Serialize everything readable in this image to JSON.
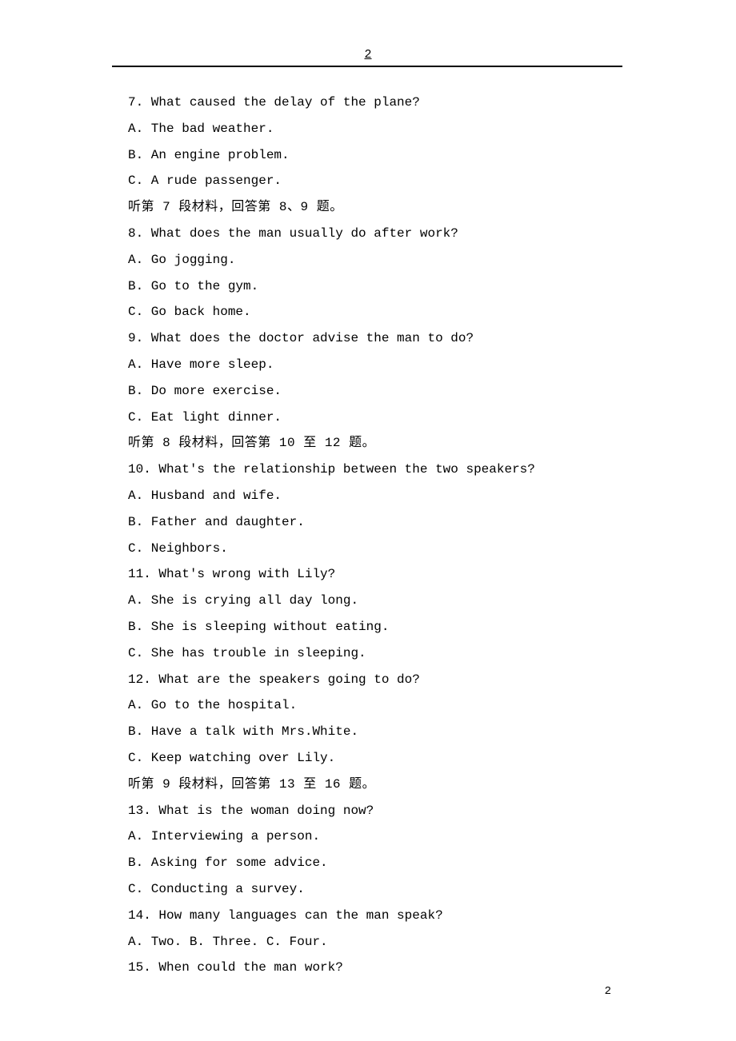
{
  "header": {
    "page_top": "2"
  },
  "lines": [
    {
      "cls": "english",
      "text": "7. What caused the delay of the plane?"
    },
    {
      "cls": "english",
      "text": "A. The bad weather."
    },
    {
      "cls": "english",
      "text": "B. An engine problem."
    },
    {
      "cls": "english",
      "text": "C. A rude passenger."
    },
    {
      "cls": "",
      "text": "听第 7 段材料，回答第 8、9 题。"
    },
    {
      "cls": "english",
      "text": "8. What does the man usually do after work?"
    },
    {
      "cls": "english",
      "text": "A. Go jogging."
    },
    {
      "cls": "english",
      "text": "B. Go to the gym."
    },
    {
      "cls": "english",
      "text": "C. Go back home."
    },
    {
      "cls": "english",
      "text": "9. What does the doctor advise the man to do?"
    },
    {
      "cls": "english",
      "text": "A. Have more sleep."
    },
    {
      "cls": "english",
      "text": "B. Do more exercise."
    },
    {
      "cls": "english",
      "text": "C. Eat light dinner."
    },
    {
      "cls": "",
      "text": "听第 8 段材料，回答第 10 至 12 题。"
    },
    {
      "cls": "english",
      "text": "10. What's the relationship between the two speakers?"
    },
    {
      "cls": "english",
      "text": "A. Husband and wife."
    },
    {
      "cls": "english",
      "text": "B. Father and daughter."
    },
    {
      "cls": "english",
      "text": "C. Neighbors."
    },
    {
      "cls": "english",
      "text": "11. What's wrong with Lily?"
    },
    {
      "cls": "english",
      "text": "A. She is crying all day long."
    },
    {
      "cls": "english",
      "text": "B. She is sleeping without eating."
    },
    {
      "cls": "english",
      "text": "C. She has trouble in sleeping."
    },
    {
      "cls": "english",
      "text": "12. What are the speakers going to do?"
    },
    {
      "cls": "english",
      "text": "A. Go to the hospital."
    },
    {
      "cls": "english",
      "text": "B. Have a talk with Mrs.White."
    },
    {
      "cls": "english",
      "text": "C. Keep watching over Lily."
    },
    {
      "cls": "",
      "text": "听第 9 段材料，回答第 13 至 16 题。"
    },
    {
      "cls": "english",
      "text": "13. What is the woman doing now?"
    },
    {
      "cls": "english",
      "text": "A. Interviewing a person."
    },
    {
      "cls": "english",
      "text": "B. Asking for some advice."
    },
    {
      "cls": "english",
      "text": "C. Conducting a survey."
    },
    {
      "cls": "english",
      "text": "14. How many languages can the man speak?"
    },
    {
      "cls": "english",
      "text": "A. Two.  B. Three.  C. Four."
    },
    {
      "cls": "english",
      "text": "15. When could the man work?"
    }
  ],
  "footer": {
    "page_bottom": "2"
  }
}
